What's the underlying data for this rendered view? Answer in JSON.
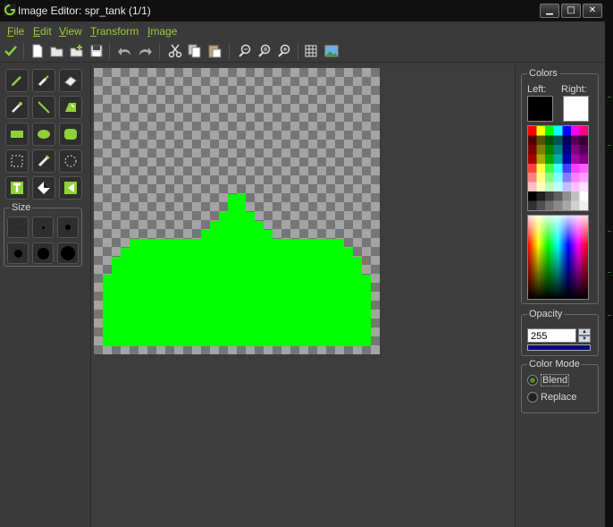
{
  "window": {
    "title": "Image Editor: spr_tank (1/1)"
  },
  "titlebar_buttons": {
    "minimize": "▁",
    "maximize": "□",
    "close": "✕"
  },
  "menu": [
    {
      "key": "F",
      "rest": "ile"
    },
    {
      "key": "E",
      "rest": "dit"
    },
    {
      "key": "V",
      "rest": "iew"
    },
    {
      "key": "T",
      "rest": "ransform"
    },
    {
      "key": "I",
      "rest": "mage"
    }
  ],
  "toolbar": {
    "icons": [
      "checkmark-icon",
      "new-file-icon",
      "open-folder-icon",
      "add-folder-icon",
      "save-icon",
      "undo-icon",
      "redo-icon",
      "cut-icon",
      "copy-icon",
      "paste-icon",
      "zoom-out-icon",
      "zoom-reset-icon",
      "zoom-in-icon",
      "grid-icon",
      "image-icon"
    ]
  },
  "tools": [
    "pencil-icon",
    "spray-icon",
    "eraser-icon",
    "color-picker-icon",
    "line-icon",
    "fill-icon",
    "rectangle-icon",
    "ellipse-icon",
    "rounded-rect-icon",
    "select-rect-icon",
    "magic-wand-icon",
    "select-ellipse-icon",
    "text-icon",
    "change-color-icon",
    "flip-icon"
  ],
  "size": {
    "label": "Size"
  },
  "colors": {
    "label": "Colors",
    "left_label": "Left:",
    "right_label": "Right:",
    "left_color": "#000000",
    "right_color": "#ffffff"
  },
  "opacity": {
    "label": "Opacity",
    "value": "255"
  },
  "color_mode": {
    "label": "Color Mode",
    "options": [
      {
        "label": "Blend",
        "selected": true
      },
      {
        "label": "Replace",
        "selected": false
      }
    ]
  },
  "sprite": {
    "fill_color": "#00ff00",
    "checker_light": "#a4a4a4",
    "checker_dark": "#767676"
  }
}
